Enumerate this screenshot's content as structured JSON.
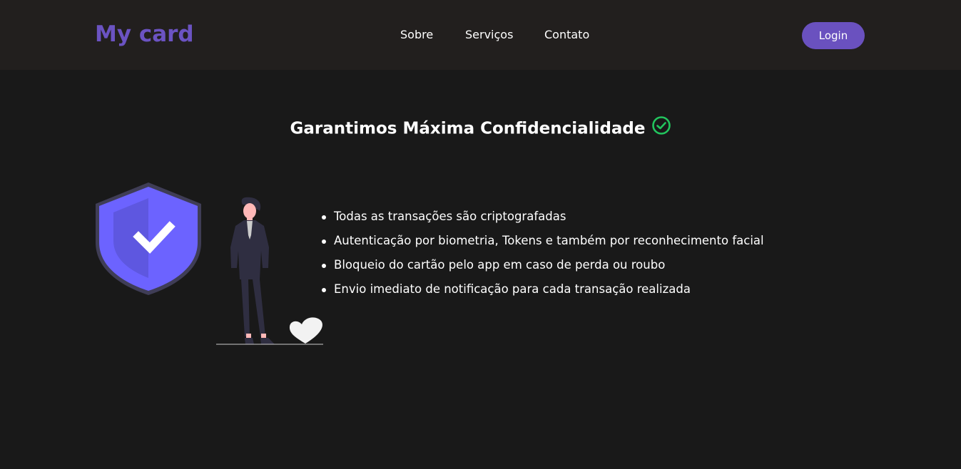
{
  "header": {
    "logo": "My card",
    "nav": [
      {
        "label": "Sobre"
      },
      {
        "label": "Serviços"
      },
      {
        "label": "Contato"
      }
    ],
    "login_label": "Login"
  },
  "section": {
    "title": "Garantimos Máxima Confidencialidade",
    "title_icon": "check-circle-icon",
    "features": [
      "Todas as transações são criptografadas",
      "Autenticação por biometria, Tokens e também por reconhecimento facial",
      "Bloqueio do cartão pelo app em caso de perda ou roubo",
      "Envio imediato de notificação para cada transação realizada"
    ]
  },
  "colors": {
    "background": "#191919",
    "header_bg": "#221f1e",
    "brand": "#6b53c2",
    "button": "#6a51bf",
    "shield": "#6c63ff",
    "check_green": "#22c55e"
  }
}
